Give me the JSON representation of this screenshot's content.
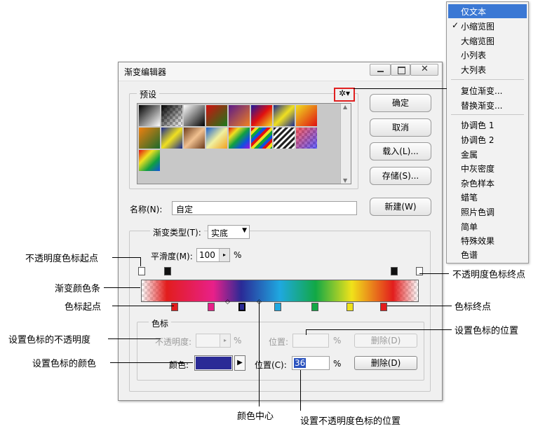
{
  "dialog": {
    "title": "渐变编辑器",
    "presets_label": "预设",
    "buttons": {
      "ok": "确定",
      "cancel": "取消",
      "load": "载入(L)...",
      "save": "存储(S)...",
      "new": "新建(W)"
    },
    "name_label": "名称(N):",
    "name_value": "自定",
    "gradient_type_label": "渐变类型(T):",
    "gradient_type_value": "实底",
    "smoothness_label": "平滑度(M):",
    "smoothness_value": "100",
    "percent": "%",
    "stops_group": "色标",
    "opacity_label": "不透明度:",
    "position_label_disabled": "位置:",
    "delete_label": "删除(D)",
    "color_label": "颜色:",
    "position_label": "位置(C):",
    "position_value": "36",
    "color_swatch": "#2a2a96"
  },
  "menu": {
    "items": [
      "仅文本",
      "小缩览图",
      "大缩览图",
      "小列表",
      "大列表",
      "复位渐变...",
      "替换渐变...",
      "协调色 1",
      "协调色 2",
      "金属",
      "中灰密度",
      "杂色样本",
      "蜡笔",
      "照片色调",
      "简单",
      "特殊效果",
      "色谱"
    ],
    "selected": "仅文本",
    "checked": "小缩览图",
    "check_mark": "✓"
  },
  "annotations": {
    "opacity_start": "不透明度色标起点",
    "gradient_bar": "渐变颜色条",
    "color_start": "色标起点",
    "set_opacity": "设置色标的不透明度",
    "set_color": "设置色标的颜色",
    "opacity_end": "不透明度色标终点",
    "color_end": "色标终点",
    "set_color_position": "设置色标的位置",
    "color_center": "颜色中心",
    "set_opacity_position": "设置不透明度色标的位置"
  }
}
